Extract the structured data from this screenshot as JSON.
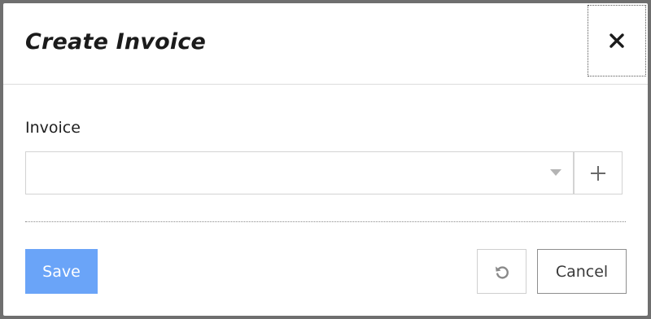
{
  "dialog": {
    "title": "Create Invoice",
    "close_icon": "close-icon"
  },
  "form": {
    "invoice_label": "Invoice",
    "invoice_value": "",
    "dropdown_icon": "caret-down-icon",
    "add_icon": "plus-icon"
  },
  "footer": {
    "save_label": "Save",
    "reset_icon": "undo-icon",
    "cancel_label": "Cancel"
  },
  "colors": {
    "primary": "#6aa4f8",
    "overlay": "#6f6f6f",
    "text": "#1b1b1b"
  }
}
